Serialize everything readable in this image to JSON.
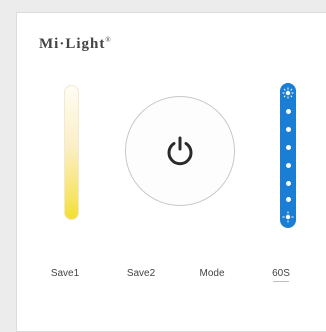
{
  "panel": {
    "brand": "Mi·Light",
    "brand_mark": "®",
    "buttons": {
      "save1": "Save1",
      "save2": "Save2",
      "mode": "Mode",
      "timer": "60S"
    }
  },
  "icons": {
    "power": "power-icon",
    "brightness_high": "sun-icon",
    "brightness_low": "sun-icon"
  },
  "colors": {
    "brightness_bar": "#1a7fd4",
    "warm_end": "#f2df2a",
    "cool_end": "#fffdf4"
  }
}
